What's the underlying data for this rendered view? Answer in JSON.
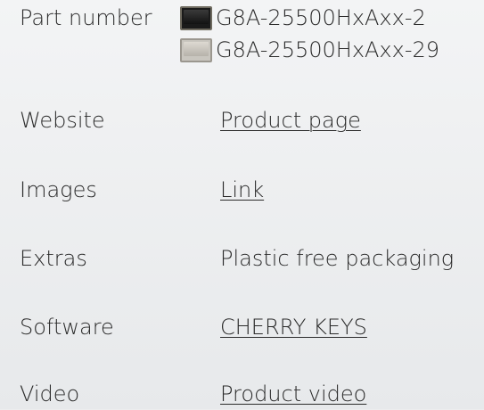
{
  "part_number": {
    "label": "Part number",
    "items": [
      {
        "code": "G8A-25500HxAxx-2",
        "swatch_color": "#1a1a1a",
        "swatch_icon": "black-keycap-swatch-icon"
      },
      {
        "code": "G8A-25500HxAxx-29",
        "swatch_color": "#c9c6bf",
        "swatch_icon": "grey-keycap-swatch-icon"
      }
    ]
  },
  "website": {
    "label": "Website",
    "link_text": "Product page"
  },
  "images": {
    "label": "Images",
    "link_text": "Link"
  },
  "extras": {
    "label": "Extras",
    "value": "Plastic free packaging"
  },
  "software": {
    "label": "Software",
    "link_text": "CHERRY KEYS"
  },
  "video": {
    "label": "Video",
    "link_text": "Product video"
  }
}
